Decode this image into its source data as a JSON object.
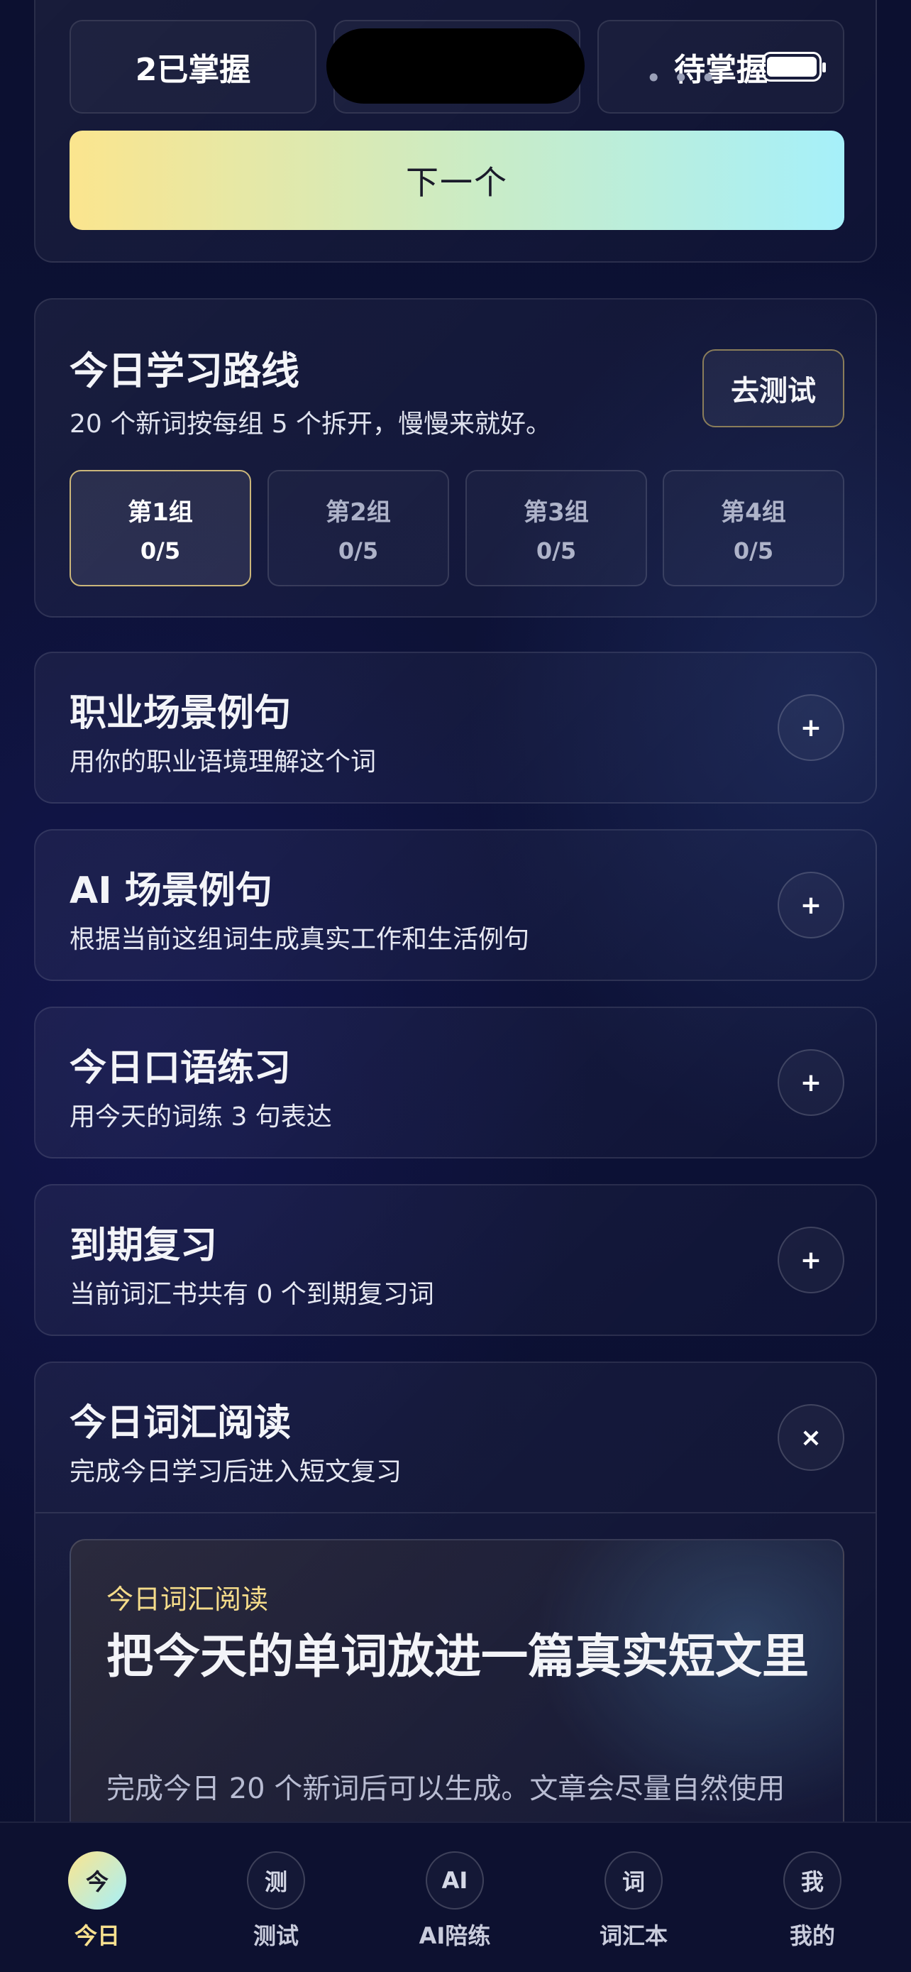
{
  "top": {
    "stats": [
      "2已掌握",
      "",
      "待掌握"
    ],
    "status_dots": "• • •",
    "next_button": "下一个"
  },
  "route": {
    "title": "今日学习路线",
    "subtitle": "20 个新词按每组 5 个拆开，慢慢来就好。",
    "test_button": "去测试",
    "groups": [
      {
        "name": "第1组",
        "progress": "0/5"
      },
      {
        "name": "第2组",
        "progress": "0/5"
      },
      {
        "name": "第3组",
        "progress": "0/5"
      },
      {
        "name": "第4组",
        "progress": "0/5"
      }
    ]
  },
  "sections": [
    {
      "title": "职业场景例句",
      "subtitle": "用你的职业语境理解这个词",
      "toggle": "+"
    },
    {
      "title": "AI 场景例句",
      "subtitle": "根据当前这组词生成真实工作和生活例句",
      "toggle": "+"
    },
    {
      "title": "今日口语练习",
      "subtitle": "用今天的词练 3 句表达",
      "toggle": "+"
    },
    {
      "title": "到期复习",
      "subtitle": "当前词汇书共有 0 个到期复习词",
      "toggle": "+"
    }
  ],
  "reading": {
    "title": "今日词汇阅读",
    "subtitle": "完成今日学习后进入短文复习",
    "toggle": "×",
    "eyebrow": "今日词汇阅读",
    "headline": "把今天的单词放进一篇真实短文里",
    "body": "完成今日 20 个新词后可以生成。文章会尽量自然使用"
  },
  "nav": [
    {
      "icon": "今",
      "label": "今日"
    },
    {
      "icon": "测",
      "label": "测试"
    },
    {
      "icon": "AI",
      "label": "AI陪练"
    },
    {
      "icon": "词",
      "label": "词汇本"
    },
    {
      "icon": "我",
      "label": "我的"
    }
  ]
}
